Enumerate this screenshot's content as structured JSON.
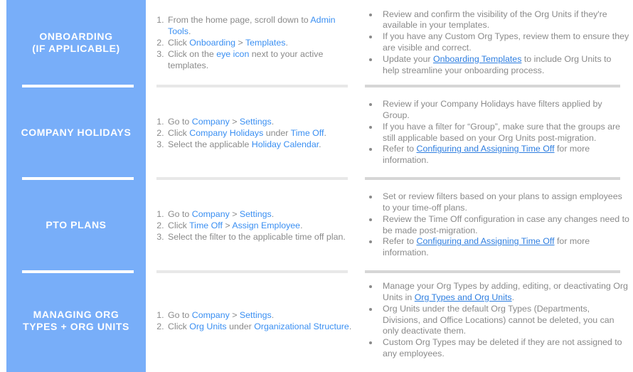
{
  "rows": [
    {
      "category": "ONBOARDING (IF APPLICABLE)",
      "category_lines": [
        "ONBOARDING",
        "(IF APPLICABLE)"
      ],
      "steps": [
        [
          {
            "t": "From the home page, scroll down to "
          },
          {
            "t": "Admin Tools",
            "hl": true
          },
          {
            "t": "."
          }
        ],
        [
          {
            "t": "Click "
          },
          {
            "t": "Onboarding",
            "hl": true
          },
          {
            "t": " > "
          },
          {
            "t": "Templates",
            "hl": true
          },
          {
            "t": "."
          }
        ],
        [
          {
            "t": "Click on the "
          },
          {
            "t": "eye icon",
            "hl": true
          },
          {
            "t": " next to your active templates."
          }
        ]
      ],
      "notes": [
        [
          {
            "t": "Review and confirm the visibility of the Org Units if they're available in your templates."
          }
        ],
        [
          {
            "t": "If you have any Custom Org Types, review them to ensure they are visible and correct."
          }
        ],
        [
          {
            "t": "Update your "
          },
          {
            "t": "Onboarding Templates",
            "link": true
          },
          {
            "t": " to include Org Units to help streamline your onboarding process."
          }
        ]
      ]
    },
    {
      "category": "COMPANY HOLIDAYS",
      "category_lines": [
        "COMPANY HOLIDAYS"
      ],
      "steps": [
        [
          {
            "t": "Go to "
          },
          {
            "t": "Company",
            "hl": true
          },
          {
            "t": " > "
          },
          {
            "t": "Settings",
            "hl": true
          },
          {
            "t": "."
          }
        ],
        [
          {
            "t": "Click "
          },
          {
            "t": "Company Holidays",
            "hl": true
          },
          {
            "t": " under "
          },
          {
            "t": "Time Off",
            "hl": true
          },
          {
            "t": "."
          }
        ],
        [
          {
            "t": "Select the applicable "
          },
          {
            "t": "Holiday Calendar",
            "hl": true
          },
          {
            "t": "."
          }
        ]
      ],
      "notes": [
        [
          {
            "t": "Review if your Company Holidays have filters applied by Group."
          }
        ],
        [
          {
            "t": "If you have a filter for “Group”, make sure that the groups are still applicable based on your Org Units post-migration."
          }
        ],
        [
          {
            "t": "Refer to "
          },
          {
            "t": "Configuring and Assigning Time Off",
            "link": true
          },
          {
            "t": " for more information."
          }
        ]
      ]
    },
    {
      "category": "PTO PLANS",
      "category_lines": [
        "PTO PLANS"
      ],
      "steps": [
        [
          {
            "t": "Go to "
          },
          {
            "t": "Company",
            "hl": true
          },
          {
            "t": " > "
          },
          {
            "t": "Settings",
            "hl": true
          },
          {
            "t": "."
          }
        ],
        [
          {
            "t": "Click "
          },
          {
            "t": "Time Off",
            "hl": true
          },
          {
            "t": " > "
          },
          {
            "t": "Assign Employee",
            "hl": true
          },
          {
            "t": "."
          }
        ],
        [
          {
            "t": "Select the filter to the applicable time off plan."
          }
        ]
      ],
      "notes": [
        [
          {
            "t": "Set or review filters based on your plans to assign employees to your time-off plans."
          }
        ],
        [
          {
            "t": "Review the Time Off configuration in case any changes need to be made post-migration."
          }
        ],
        [
          {
            "t": "Refer to "
          },
          {
            "t": "Configuring and Assigning Time Off",
            "link": true
          },
          {
            "t": " for more information."
          }
        ]
      ]
    },
    {
      "category": "MANAGING ORG TYPES + ORG UNITS",
      "category_lines": [
        "MANAGING ORG",
        "TYPES + ORG UNITS"
      ],
      "steps": [
        [
          {
            "t": "Go to "
          },
          {
            "t": "Company",
            "hl": true
          },
          {
            "t": " > "
          },
          {
            "t": "Settings",
            "hl": true
          },
          {
            "t": "."
          }
        ],
        [
          {
            "t": "Click "
          },
          {
            "t": "Org Units",
            "hl": true
          },
          {
            "t": " under "
          },
          {
            "t": "Organizational Structure",
            "hl": true
          },
          {
            "t": "."
          }
        ]
      ],
      "notes": [
        [
          {
            "t": "Manage your Org Types by adding, editing,  or deactivating Org Units in "
          },
          {
            "t": "Org Types and Org Units",
            "link": true
          },
          {
            "t": "."
          }
        ],
        [
          {
            "t": "Org Units under the default Org Types (Departments, Divisions, and Office Locations) cannot be deleted, you can only deactivate them."
          }
        ],
        [
          {
            "t": "Custom Org Types may be deleted if they are not assigned to any employees."
          }
        ]
      ]
    }
  ],
  "colors": {
    "category_bg": "#78aef9",
    "highlight": "#3a8ff2",
    "link": "#2e7ee0",
    "body_text": "#8a8a8a"
  }
}
